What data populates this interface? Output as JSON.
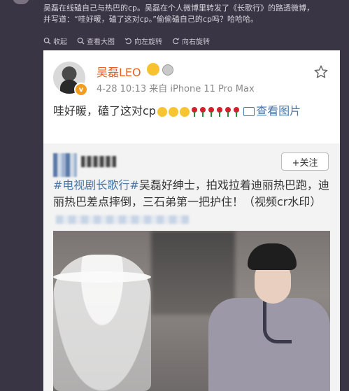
{
  "caption": {
    "line1": "吴磊在线磕自己与热巴的cp。吴磊在个人微博里转发了《长歌行》的路透微博，",
    "line2": "并写道：“哇好暖，磕了这对cp。”偷偷磕自己的cp吗？哈哈哈。"
  },
  "toolbar": {
    "zoom_label": "收起",
    "view_large_label": "查看大图",
    "rotate_left_label": "向左旋转",
    "rotate_right_label": "向右旋转"
  },
  "post": {
    "username": "吴磊LEO",
    "meta": "4-28 10:13  来自 iPhone 11 Pro Max",
    "text": "哇好暖，磕了这对cp",
    "view_image_label": "查看图片",
    "verified_badge": "v"
  },
  "retweet": {
    "follow_label": "+关注",
    "hashtag": "#电视剧长歌行#",
    "text": "吴磊好绅士，拍戏拉着迪丽热巴跑，迪丽热巴差点摔倒，三石弟第一把护住！（视频cr水印）"
  },
  "colors": {
    "accent_orange": "#e8601f",
    "link_blue": "#4a76a8",
    "panel_bg": "#3a3545"
  },
  "icons": [
    "zoom-icon",
    "search-icon",
    "rotate-left-icon",
    "rotate-right-icon",
    "star-icon",
    "crown-icon",
    "medal-icon",
    "image-icon"
  ]
}
